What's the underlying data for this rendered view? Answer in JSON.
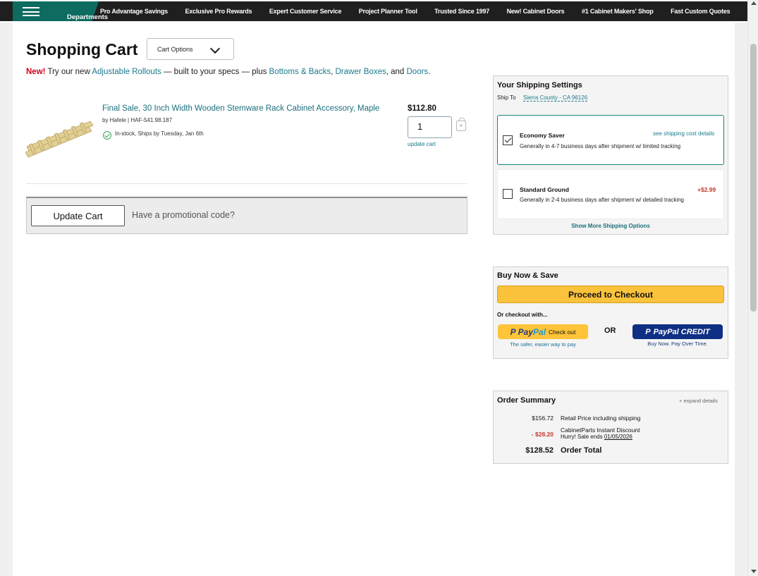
{
  "nav": {
    "departments": "Departments",
    "items": [
      "Pro Advantage Savings",
      "Exclusive Pro Rewards",
      "Expert Customer Service",
      "Project Planner Tool",
      "Trusted Since 1997",
      "New! Cabinet Doors",
      "#1 Cabinet Makers' Shop",
      "Fast Custom Quotes"
    ]
  },
  "cart": {
    "title": "Shopping Cart",
    "options_label": "Cart Options"
  },
  "promo_line": {
    "new": "New!",
    "t1": " Try our new ",
    "link1": "Adjustable Rollouts",
    "t2": " — built to your specs — plus ",
    "link2": "Bottoms & Backs",
    "t3": ", ",
    "link3": "Drawer Boxes",
    "t4": ", and ",
    "link4": "Doors",
    "t5": "."
  },
  "item": {
    "name": "Final Sale, 30 Inch Width Wooden Stemware Rack Cabinet Accessory, Maple",
    "by": "by Hafele | HAF-541.98.187",
    "stock": "In-stock, Ships by Tuesday, Jan 6th",
    "price": "$112.80",
    "quantity": "1",
    "update_link": "update cart"
  },
  "actions": {
    "update_cart": "Update Cart",
    "promo_prompt": "Have a promotional code?"
  },
  "shipping": {
    "heading": "Your Shipping Settings",
    "ship_to_label": "Ship To",
    "ship_to_value": "Sierra County - CA 96126",
    "options": [
      {
        "name": "Economy Saver",
        "desc": "Generally in 4-7 business days after shipment w/ limited tracking",
        "link": "see shipping cost details",
        "checked": true
      },
      {
        "name": "Standard Ground",
        "desc": "Generally in 2-4 business days after shipment w/ detailed tracking",
        "price": "+$2.99",
        "checked": false
      }
    ],
    "more": "Show More Shipping Options"
  },
  "buy": {
    "heading": "Buy Now & Save",
    "checkout": "Proceed to Checkout",
    "or_with": "Or checkout with...",
    "paypal_pay": "Pay",
    "paypal_pal": "Pal",
    "paypal_checkout": "Check out",
    "paypal_sub": "The safer, easier way to pay",
    "or": "OR",
    "paypal_credit": "PayPal CREDIT",
    "credit_sub": "Buy Now. Pay Over Time."
  },
  "summary": {
    "heading": "Order Summary",
    "expand": "+ expand details",
    "retail_amount": "$156.72",
    "retail_label": "Retail Price including shipping",
    "discount_amount": "- $28.20",
    "discount_label": "CabinetParts Instant Discount",
    "sale_prefix": "Hurry! Sale ends ",
    "sale_date": "01/05/2026",
    "total_amount": "$128.52",
    "total_label": "Order Total"
  },
  "colors": {
    "brand_teal": "#0d6b60",
    "link": "#1a7a8c",
    "checkout_yellow": "#fbc23b",
    "discount_red": "#c0392b"
  }
}
